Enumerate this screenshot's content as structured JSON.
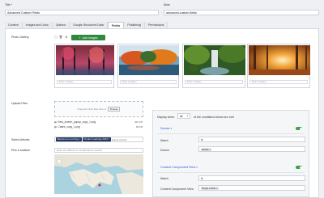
{
  "fields": {
    "title_label": "Title *",
    "title_value": "Advanced Custom Fields",
    "alias_label": "Alias",
    "alias_value": "advanced-custom-fields"
  },
  "tabs": [
    {
      "label": "Content"
    },
    {
      "label": "Images and Links"
    },
    {
      "label": "Options"
    },
    {
      "label": "Google Structured Data"
    },
    {
      "label": "Fields"
    },
    {
      "label": "Publishing"
    },
    {
      "label": "Permissions"
    }
  ],
  "active_tab": "Fields",
  "gallery": {
    "label": "Photo Gallery",
    "add_button": "Add Images",
    "caption_placeholder": "Enter a caption",
    "images": [
      {
        "icon": "autumn-trees-image"
      },
      {
        "icon": "autumn-lake-image"
      },
      {
        "icon": "forest-waterfall-image"
      },
      {
        "icon": "sunset-forest-image"
      }
    ]
  },
  "upload": {
    "label": "Upload Files",
    "drop_text": "Drag and drop files here or",
    "browse_label": "Browse",
    "files": [
      {
        "name": "New_screen_popup_copy_1.png",
        "size": "463 KB"
      },
      {
        "name": "Cases_copy_1.png",
        "size": "88 KB"
      }
    ]
  },
  "articles": {
    "label": "Select Articles",
    "chips": [
      "Welcome to our blog ×",
      "Product roadmap 2023 ×"
    ],
    "placeholder": "Select articles"
  },
  "location": {
    "label": "Pick a location",
    "placeholder": "Enter an address or coordinates to search"
  },
  "conditions": {
    "display_when": "Display when",
    "all_value": "all",
    "suffix": "of the conditions below are met",
    "groups": [
      {
        "title": "Device",
        "match_label": "Match",
        "match_value": "Is",
        "field_label": "Device",
        "field_value": "Mobile ×"
      },
      {
        "title": "Content Component View",
        "match_label": "Match",
        "match_value": "Is",
        "field_label": "Content Component View",
        "field_value": "Single Article ×"
      }
    ]
  },
  "colors": {
    "accent_green": "#2d8a3d",
    "chip_navy": "#22345c",
    "link_blue": "#2a5bd7"
  }
}
